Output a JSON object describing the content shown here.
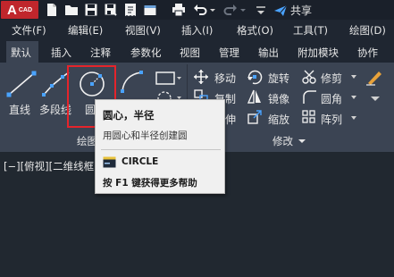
{
  "app": {
    "logo_letter": "A",
    "logo_text": "CAD",
    "share_label": "共享"
  },
  "colors": {
    "background": "#1f2631",
    "ribbon": "#3b4453",
    "accent_blue": "#4aa3ff",
    "highlight_red": "#e5242b",
    "logo_red": "#c0262c",
    "tooltip_bg": "#f0f0f0"
  },
  "quick_access": [
    "new-file-icon",
    "open-folder-icon",
    "save-icon",
    "save-as-icon",
    "print-icon",
    "undo-icon",
    "redo-icon",
    "share-icon"
  ],
  "menu": [
    "文件(F)",
    "编辑(E)",
    "视图(V)",
    "插入(I)",
    "格式(O)",
    "工具(T)",
    "绘图(D)"
  ],
  "tabs": [
    "默认",
    "插入",
    "注释",
    "参数化",
    "视图",
    "管理",
    "输出",
    "附加模块",
    "协作"
  ],
  "active_tab": "默认",
  "draw_panel": {
    "title": "绘图",
    "line_label": "直线",
    "polyline_label": "多段线",
    "circle_label": "圆"
  },
  "modify_panel": {
    "title": "修改",
    "items": [
      "移动",
      "旋转",
      "修剪",
      "复制",
      "镜像",
      "圆角",
      "拉伸",
      "缩放",
      "阵列"
    ]
  },
  "viewport_label": "[−][俯视][二维线框]",
  "tooltip": {
    "title": "圆心，半径",
    "description": "用圆心和半径创建圆",
    "command": "CIRCLE",
    "help": "按 F1 键获得更多帮助"
  }
}
